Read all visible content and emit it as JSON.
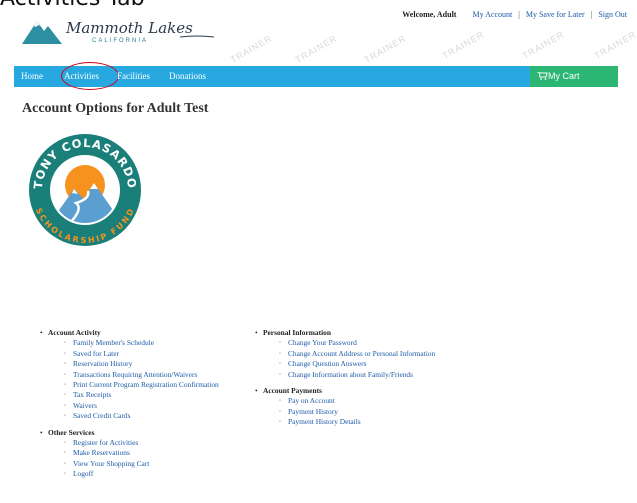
{
  "caption": "Activities Tab",
  "brand": {
    "name": "Mammoth Lakes",
    "subtitle": "CALIFORNIA",
    "colors": {
      "navbar": "#27a8e0",
      "cart": "#2bb673",
      "link": "#1b5aa8",
      "highlight": "#d0021b"
    }
  },
  "top_links": {
    "welcome": "Welcome, Adult",
    "links": [
      "My Account",
      "My Save for Later",
      "Sign Out"
    ],
    "separator": "|"
  },
  "nav": {
    "items": [
      "Home",
      "Activities",
      "Facilities",
      "Donations"
    ],
    "highlighted": "Activities",
    "cart_label": "My Cart",
    "cart_icon": "shopping-cart-icon"
  },
  "page_title": "Account Options for Adult Test",
  "badge": {
    "top_text": "TONY COLASARDO",
    "bottom_text": "SCHOLARSHIP FUND"
  },
  "watermark": "TRAINER",
  "left_sections": [
    {
      "title": "Account Activity",
      "links": [
        "Family Member's Schedule",
        "Saved for Later",
        "Reservation History",
        "Transactions Requiring Attention/Waivers",
        "Print Current Program Registration Confirmation",
        "Tax Receipts",
        "Waivers",
        "Saved Credit Cards"
      ]
    },
    {
      "title": "Other Services",
      "links": [
        "Register for Activities",
        "Make Reservations",
        "View Your Shopping Cart",
        "Logoff"
      ]
    }
  ],
  "right_sections": [
    {
      "title": "Personal Information",
      "links": [
        "Change Your Password",
        "Change Account Address or Personal Information",
        "Change Question Answers",
        "Change Information about Family/Friends"
      ]
    },
    {
      "title": "Account Payments",
      "links": [
        "Pay on Account",
        "Payment History",
        "Payment History Details"
      ]
    }
  ]
}
